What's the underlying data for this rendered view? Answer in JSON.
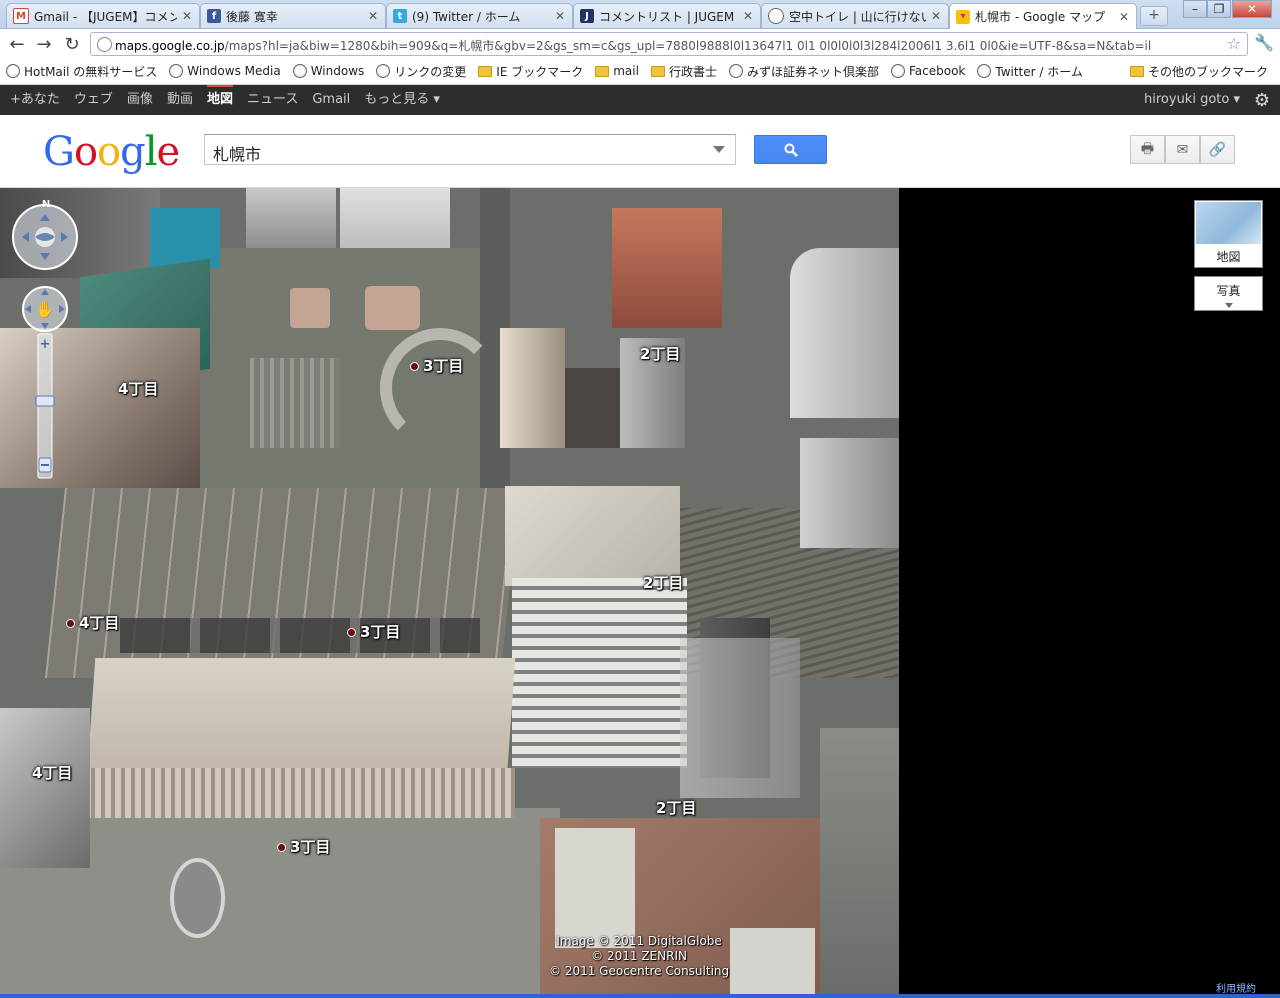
{
  "tabs": [
    {
      "title": "Gmail - 【JUGEM】コメント通",
      "icon": "gmail-icon",
      "color": "#d14836",
      "glyph": "M"
    },
    {
      "title": "後藤 寛幸",
      "icon": "facebook-icon",
      "color": "#3b5998",
      "glyph": "f"
    },
    {
      "title": "(9) Twitter / ホーム",
      "icon": "twitter-icon",
      "color": "#33aadd",
      "glyph": "t"
    },
    {
      "title": "コメントリスト | JUGEM 管理-",
      "icon": "jugem-icon",
      "color": "#223366",
      "glyph": "J"
    },
    {
      "title": "空中トイレ | 山に行けない\\bo",
      "icon": "globe-icon",
      "color": "#888888",
      "glyph": "○"
    },
    {
      "title": "札幌市 - Google マップ",
      "icon": "maps-icon",
      "color": "#f4c20d",
      "glyph": "▾"
    }
  ],
  "address": {
    "domain": "maps.google.co.jp",
    "path": "/maps?hl=ja&biw=1280&bih=909&q=札幌市&gbv=2&gs_sm=c&gs_upl=7880l9888l0l13647l1 0l1 0l0l0l0l3l284l2006l1 3.6l1 0l0&ie=UTF-8&sa=N&tab=il"
  },
  "bookmarks": [
    {
      "label": "HotMail の無料サービス",
      "icon": "globe"
    },
    {
      "label": "Windows Media",
      "icon": "globe"
    },
    {
      "label": "Windows",
      "icon": "globe"
    },
    {
      "label": "リンクの変更",
      "icon": "globe"
    },
    {
      "label": "IE ブックマーク",
      "icon": "folder"
    },
    {
      "label": "mail",
      "icon": "folder"
    },
    {
      "label": "行政書士",
      "icon": "folder"
    },
    {
      "label": "みずほ証券ネット倶楽部",
      "icon": "globe"
    },
    {
      "label": "Facebook",
      "icon": "globe"
    },
    {
      "label": "Twitter / ホーム",
      "icon": "globe"
    }
  ],
  "other_bookmarks": "その他のブックマーク",
  "gbar": {
    "items": [
      "+あなた",
      "ウェブ",
      "画像",
      "動画",
      "地図",
      "ニュース",
      "Gmail",
      "もっと見る ▾"
    ],
    "active_index": 4,
    "user": "hiroyuki goto ▾"
  },
  "search": {
    "value": "札幌市"
  },
  "map": {
    "labels": [
      {
        "text": "3丁目",
        "dot": true
      },
      {
        "text": "2丁目",
        "dot": false
      },
      {
        "text": "4丁目",
        "dot": false
      },
      {
        "text": "2丁目",
        "dot": false
      },
      {
        "text": "4丁目",
        "dot": true
      },
      {
        "text": "3丁目",
        "dot": true
      },
      {
        "text": "4丁目",
        "dot": false
      },
      {
        "text": "2丁目",
        "dot": false
      },
      {
        "text": "3丁目",
        "dot": true
      }
    ],
    "copyright": [
      "Image © 2011 DigitalGlobe",
      "© 2011 ZENRIN",
      "© 2011 Geocentre Consulting"
    ],
    "compass_n": "N"
  },
  "maptype": {
    "map": "地図",
    "photo": "写真"
  },
  "terms": "利用規約",
  "colors": {
    "search_button": "#4d90fe",
    "gbar_bg": "#2d2d2d",
    "active_accent": "#dd4b39"
  }
}
